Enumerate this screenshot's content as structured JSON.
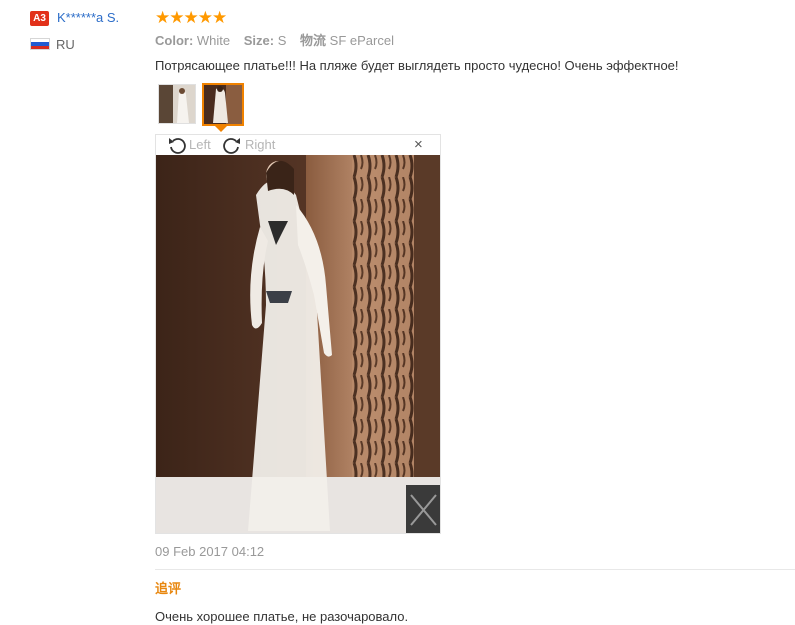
{
  "user": {
    "level_badge": "A3",
    "name": "K******a S.",
    "country": "RU",
    "flag_colors": [
      "#ffffff",
      "#1f5ad1",
      "#d52b1e"
    ]
  },
  "review": {
    "rating": 5,
    "stars": "★★★★★",
    "attributes": [
      {
        "label": "Color:",
        "value": "White"
      },
      {
        "label": "Size:",
        "value": "S"
      },
      {
        "label": "物流",
        "value": "SF eParcel"
      }
    ],
    "text": "Потрясающее платье!!! На пляже будет выглядеть просто чудесно! Очень эффектное!",
    "date": "09 Feb 2017 04:12"
  },
  "image_viewer": {
    "rotate_left_label": "Left",
    "rotate_right_label": "Right",
    "close_symbol": "×",
    "selected_thumbnail": 2
  },
  "followup": {
    "label": "追评",
    "text": "Очень хорошее платье, не разочаровало."
  },
  "colors": {
    "accent": "#f08200",
    "link": "#2d6ec9",
    "star": "#ff9900",
    "badge": "#e2311a"
  }
}
